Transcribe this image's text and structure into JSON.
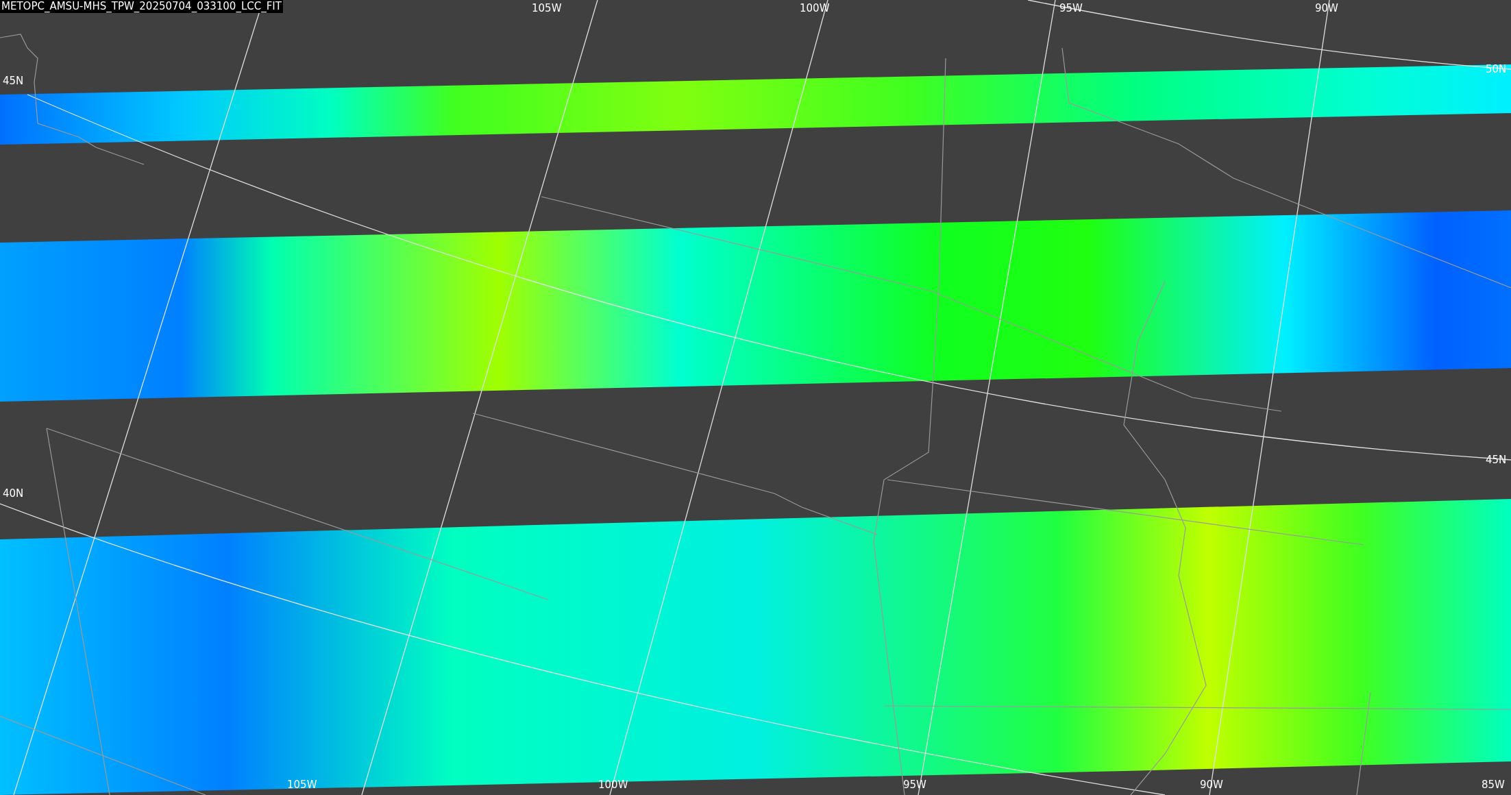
{
  "title": "METOPC_AMSU-MHS_TPW_20250704_033100_LCC_FIT",
  "map": {
    "top_labels": [
      "105W",
      "100W",
      "95W",
      "90W"
    ],
    "bottom_labels": [
      "105W",
      "100W",
      "95W",
      "90W",
      "85W"
    ],
    "left_labels": [
      "45N",
      "40N"
    ],
    "right_labels": [
      "50N",
      "45N"
    ]
  }
}
